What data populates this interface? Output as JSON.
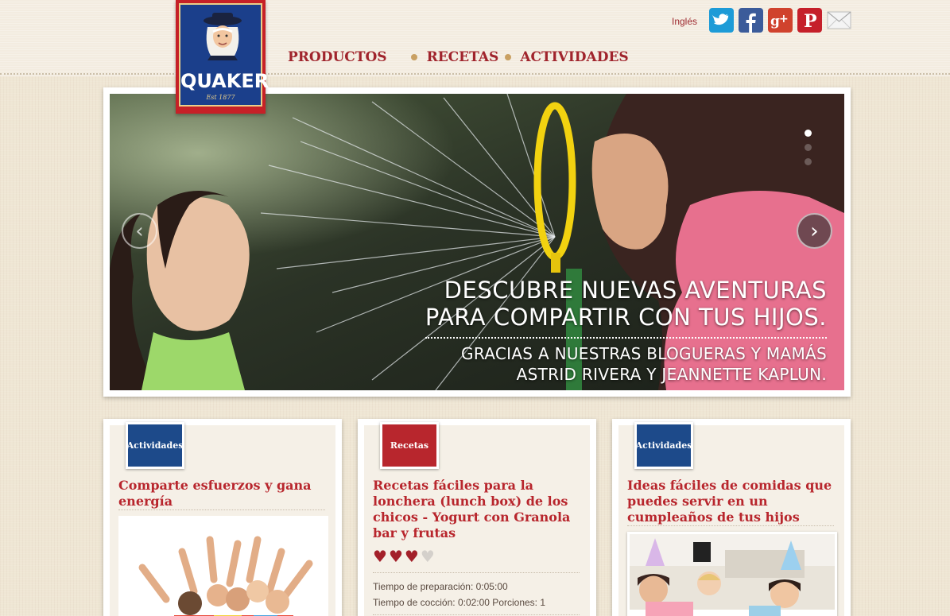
{
  "header": {
    "brand": "QUAKER",
    "brand_est": "Est 1877",
    "nav": [
      {
        "label": "PRODUCTOS"
      },
      {
        "label": "RECETAS"
      },
      {
        "label": "ACTIVIDADES"
      }
    ],
    "language_label": "Inglés",
    "social": [
      {
        "icon": "twitter-icon",
        "color": "#1d9bd7"
      },
      {
        "icon": "facebook-icon",
        "color": "#3b5b9a"
      },
      {
        "icon": "google-plus-icon",
        "color": "#d0422d"
      },
      {
        "icon": "pinterest-icon",
        "color": "#c51f2a"
      },
      {
        "icon": "email-icon",
        "color": "#eeeeee"
      }
    ]
  },
  "slider": {
    "caption_line1": "DESCUBRE NUEVAS AVENTURAS",
    "caption_line2": "PARA COMPARTIR CON TUS HIJOS.",
    "caption_line3": "GRACIAS A NUESTRAS BLOGUERAS Y MAMÁS",
    "caption_line4": "ASTRID RIVERA Y JEANNETTE KAPLUN.",
    "prev_arrow": "‹",
    "next_arrow": "›",
    "slide_count": 3,
    "active_slide": 1
  },
  "cards": [
    {
      "tag": "Actividades",
      "title": "Comparte esfuerzos y gana energía"
    },
    {
      "tag": "Recetas",
      "title": "Recetas fáciles para la lonchera (lunch box) de los chicos - Yogurt con Granola bar y frutas",
      "rating": 3,
      "rating_max": 4,
      "prep_time": "Tiempo de preparación: 0:05:00",
      "cook_time": "Tiempo de cocción: 0:02:00 Porciones: 1"
    },
    {
      "tag": "Actividades",
      "title": "Ideas fáciles de comidas que puedes servir en un cumpleaños de tus hijos"
    }
  ],
  "colors": {
    "brand_red": "#b8262d",
    "brand_blue": "#1d4a8a",
    "nav_red": "#a0242c",
    "gold": "#c9a062"
  }
}
